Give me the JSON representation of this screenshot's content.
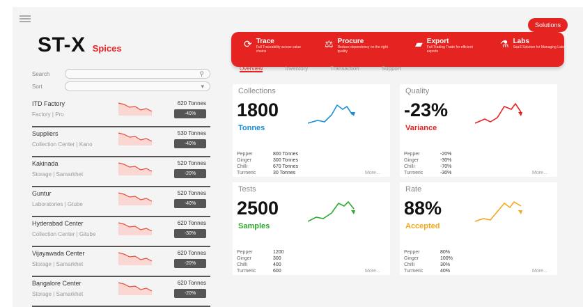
{
  "brand": {
    "name": "ST-X",
    "tagline": "Spices"
  },
  "filters": {
    "search": {
      "label": "Search",
      "icon": "search-icon"
    },
    "sort": {
      "label": "Sort",
      "icon": "chevron-down-icon"
    }
  },
  "locations": [
    {
      "name": "ITD Factory",
      "type": "Factory | Pro",
      "amount": "620 Tonnes",
      "badge": "-40%"
    },
    {
      "name": "Suppliers",
      "type": "Collection Center | Kano",
      "amount": "530 Tonnes",
      "badge": "-40%"
    },
    {
      "name": "Kakinada",
      "type": "Storage | Samarkhet",
      "amount": "520 Tonnes",
      "badge": "-20%"
    },
    {
      "name": "Guntur",
      "type": "Laboratories | Gtube",
      "amount": "520 Tonnes",
      "badge": "-40%"
    },
    {
      "name": "Hyderabad Center",
      "type": "Collection Center | Gitube",
      "amount": "620 Tonnes",
      "badge": "-30%"
    },
    {
      "name": "Vijayawada Center",
      "type": "Storage | Samarkhet",
      "amount": "620 Tonnes",
      "badge": "-20%"
    },
    {
      "name": "Bangalore Center",
      "type": "Storage | Samarkhet",
      "amount": "620 Tonnes",
      "badge": "-20%"
    }
  ],
  "solutions_button": "Solutions",
  "nav": [
    {
      "title": "Trace",
      "desc": "Full Traceability across value chains",
      "icon": "trace-icon"
    },
    {
      "title": "Procure",
      "desc": "Reduce dependency on the right quality",
      "icon": "procure-icon"
    },
    {
      "title": "Export",
      "desc": "Full Trading Trade for efficient exports",
      "icon": "truck-icon"
    },
    {
      "title": "Labs",
      "desc": "SaaS Solution for Managing Labs",
      "icon": "flask-icon"
    }
  ],
  "subtabs": [
    "Overview",
    "Inventory",
    "Transaction",
    "Support"
  ],
  "cards": [
    {
      "label": "Collections",
      "value": "1800",
      "unit": "Tonnes",
      "color": "#1a8fd6",
      "rows": [
        [
          "Pepper",
          "800 Tonnes"
        ],
        [
          "Ginger",
          "300 Tonnes"
        ],
        [
          "Chilli",
          "670 Tonnes"
        ],
        [
          "Turmeric",
          "30 Tonnes"
        ]
      ],
      "more": "More..."
    },
    {
      "label": "Quality",
      "value": "-23%",
      "unit": "Variance",
      "color": "#e52421",
      "rows": [
        [
          "Pepper",
          "-20%"
        ],
        [
          "Ginger",
          "-30%"
        ],
        [
          "Chilli",
          "-70%"
        ],
        [
          "Turmeric",
          "-30%"
        ]
      ],
      "more": "More..."
    },
    {
      "label": "Tests",
      "value": "2500",
      "unit": "Samples",
      "color": "#2eaa2e",
      "rows": [
        [
          "Pepper",
          "1200"
        ],
        [
          "Ginger",
          "300"
        ],
        [
          "Chilli",
          "400"
        ],
        [
          "Turmeric",
          "600"
        ]
      ],
      "more": "More..."
    },
    {
      "label": "Rate",
      "value": "88%",
      "unit": "Accepted",
      "color": "#f4a81d",
      "rows": [
        [
          "Pepper",
          "80%"
        ],
        [
          "Ginger",
          "100%"
        ],
        [
          "Chilli",
          "30%"
        ],
        [
          "Turmeric",
          "40%"
        ]
      ],
      "more": "More..."
    }
  ]
}
